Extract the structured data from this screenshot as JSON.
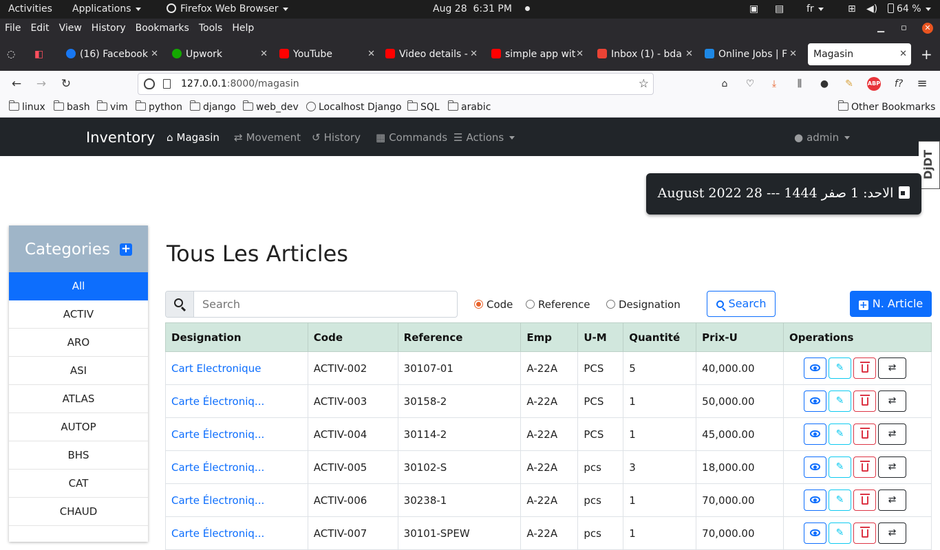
{
  "os": {
    "activities": "Activities",
    "applications": "Applications",
    "app_name": "Firefox Web Browser",
    "date": "Aug 28",
    "time": "6:31 PM",
    "lang": "fr",
    "battery": "64 %"
  },
  "menubar": [
    "File",
    "Edit",
    "View",
    "History",
    "Bookmarks",
    "Tools",
    "Help"
  ],
  "tabs": [
    {
      "title": "(16) Facebook",
      "color": "#1877f2"
    },
    {
      "title": "Upwork",
      "color": "#14a800"
    },
    {
      "title": "YouTube",
      "color": "#ff0000"
    },
    {
      "title": "Video details -",
      "color": "#ff0000"
    },
    {
      "title": "simple app wit",
      "color": "#ff0000"
    },
    {
      "title": "Inbox (1) - bda",
      "color": "#ea4335"
    },
    {
      "title": "Online Jobs | F",
      "color": "#1e88e5"
    },
    {
      "title": "Magasin",
      "color": "#ffffff"
    }
  ],
  "url": {
    "host": "127.0.0.1",
    "rest": ":8000/magasin"
  },
  "bookmarks": [
    "linux",
    "bash",
    "vim",
    "python",
    "django",
    "web_dev",
    "Localhost Django",
    "SQL",
    "arabic"
  ],
  "other_bookmarks": "Other Bookmarks",
  "app": {
    "brand": "Inventory",
    "nav": [
      "Magasin",
      "Movement",
      "History",
      "Commands",
      "Actions"
    ],
    "user": "admin",
    "djdt": "DjDT",
    "date_label": "الاحد: 1 صفر 1444 --- 28 August 2022"
  },
  "sidebar": {
    "title": "Categories",
    "items": [
      "All",
      "ACTIV",
      "ARO",
      "ASI",
      "ATLAS",
      "AUTOP",
      "BHS",
      "CAT",
      "CHAUD"
    ]
  },
  "main": {
    "title": "Tous Les Articles",
    "search_placeholder": "Search",
    "radio_options": [
      "Code",
      "Reference",
      "Designation"
    ],
    "search_button": "Search",
    "new_button": "N. Article"
  },
  "table": {
    "headers": [
      "Designation",
      "Code",
      "Reference",
      "Emp",
      "U-M",
      "Quantité",
      "Prix-U",
      "Operations"
    ],
    "rows": [
      [
        "Cart Electronique",
        "ACTIV-002",
        "30107-01",
        "A-22A",
        "PCS",
        "5",
        "40,000.00"
      ],
      [
        "Carte Électroniq...",
        "ACTIV-003",
        "30158-2",
        "A-22A",
        "PCS",
        "1",
        "50,000.00"
      ],
      [
        "Carte Électroniq...",
        "ACTIV-004",
        "30114-2",
        "A-22A",
        "PCS",
        "1",
        "45,000.00"
      ],
      [
        "Carte Électroniq...",
        "ACTIV-005",
        "30102-S",
        "A-22A",
        "pcs",
        "3",
        "18,000.00"
      ],
      [
        "Carte Électroniq...",
        "ACTIV-006",
        "30238-1",
        "A-22A",
        "pcs",
        "1",
        "70,000.00"
      ],
      [
        "Carte Électroniq...",
        "ACTIV-007",
        "30101-SPEW",
        "A-22A",
        "pcs",
        "1",
        "70,000.00"
      ]
    ]
  }
}
